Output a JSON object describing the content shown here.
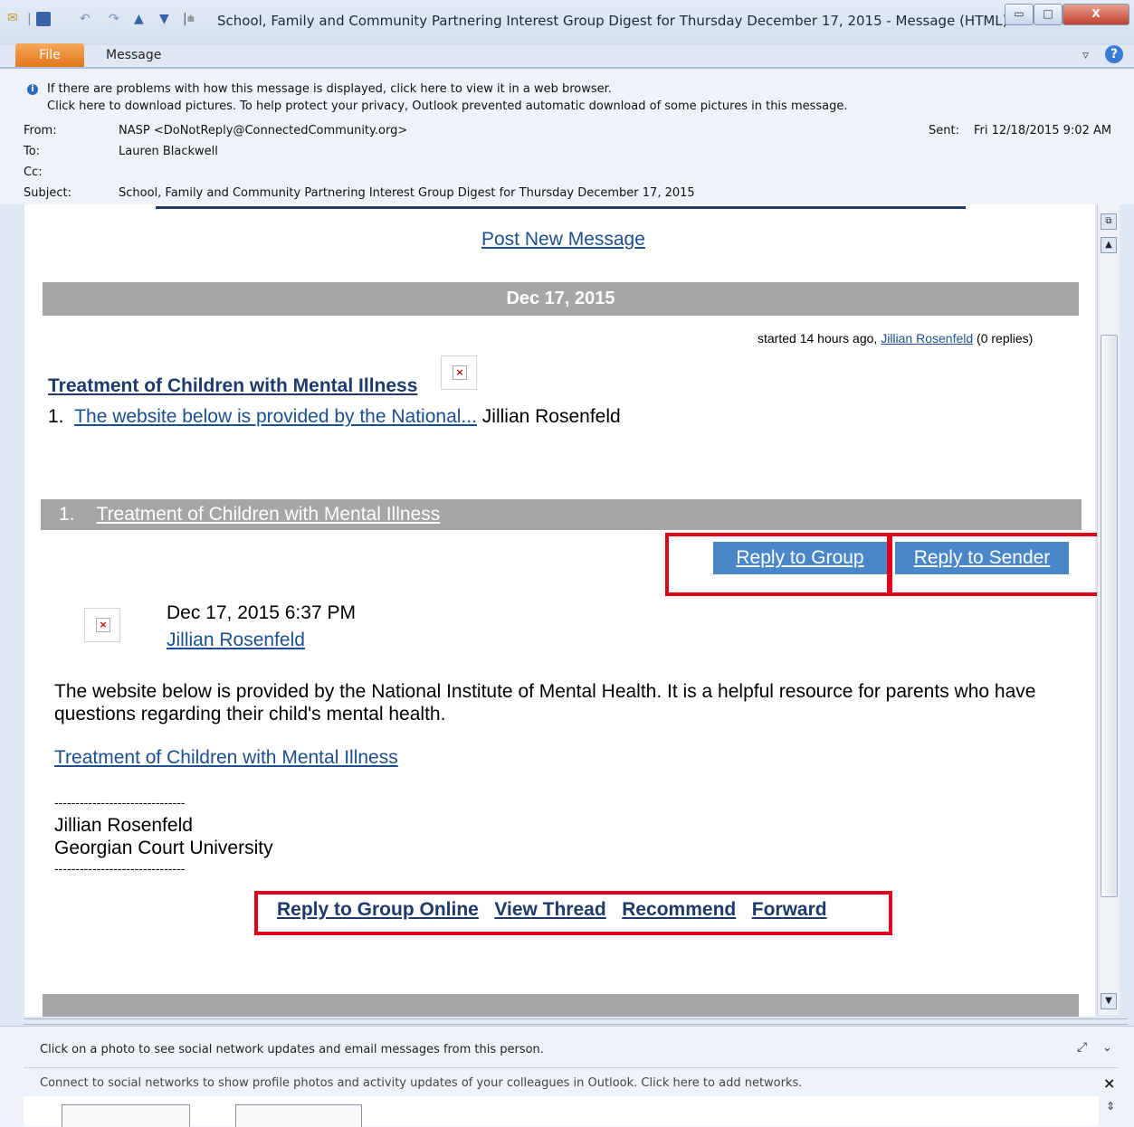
{
  "window": {
    "title": "School, Family and Community Partnering Interest Group Digest for Thursday December 17, 2015  -  Message (HTML)",
    "minimize": "▭",
    "maximize": "□",
    "close": "X"
  },
  "ribbon": {
    "file_tab": "File",
    "message_tab": "Message",
    "help": "?",
    "collapse": "▿"
  },
  "info_bar": {
    "line1": "If there are problems with how this message is displayed, click here to view it in a web browser.",
    "line2": "Click here to download pictures. To help protect your privacy, Outlook prevented automatic download of some pictures in this message."
  },
  "header": {
    "from_label": "From:",
    "from_value": "NASP <DoNotReply@ConnectedCommunity.org>",
    "to_label": "To:",
    "to_value": "Lauren Blackwell",
    "cc_label": "Cc:",
    "cc_value": "",
    "subject_label": "Subject:",
    "subject_value": "School, Family and Community Partnering Interest Group Digest for Thursday December 17, 2015",
    "sent_label": "Sent:",
    "sent_value": "Fri 12/18/2015 9:02 AM"
  },
  "digest": {
    "post_new_message": "Post New Message",
    "date_header": "Dec 17, 2015",
    "started_prefix": "started 14 hours ago, ",
    "started_author": "Jillian Rosenfeld",
    "started_suffix": " (0 replies)",
    "topic_title": "Treatment of Children with Mental Illness",
    "item_number": "1.",
    "item_link": "The website below is provided by the National...",
    "item_author": "Jillian Rosenfeld",
    "section_number": "1.",
    "section_title": "Treatment of Children with Mental Illness",
    "reply_group": "Reply to Group",
    "reply_sender": "Reply to Sender",
    "post_date": "Dec 17, 2015 6:37 PM",
    "post_author": "Jillian Rosenfeld",
    "body_text": "The website below is provided by the National Institute of Mental Health. It is a helpful resource for parents who have questions regarding their child's mental health.",
    "body_link": "Treatment of Children with Mental Illness",
    "sig_rule_top": "-------------------------------",
    "sig_name": "Jillian Rosenfeld",
    "sig_org": "Georgian Court University",
    "sig_rule_bottom": "-------------------------------",
    "action_reply_online": "Reply to Group Online",
    "action_view_thread": "View Thread",
    "action_recommend": "Recommend",
    "action_forward": "Forward"
  },
  "people_pane": {
    "line1": "Click on a photo to see social network updates and email messages from this person.",
    "line2": "Connect to social networks to show profile photos and activity updates of your colleagues in Outlook. Click here to add networks."
  },
  "colors": {
    "link": "#1b4f8f",
    "button": "#4a87c9",
    "highlight": "#e0001b",
    "bar": "#a6a6a6"
  }
}
